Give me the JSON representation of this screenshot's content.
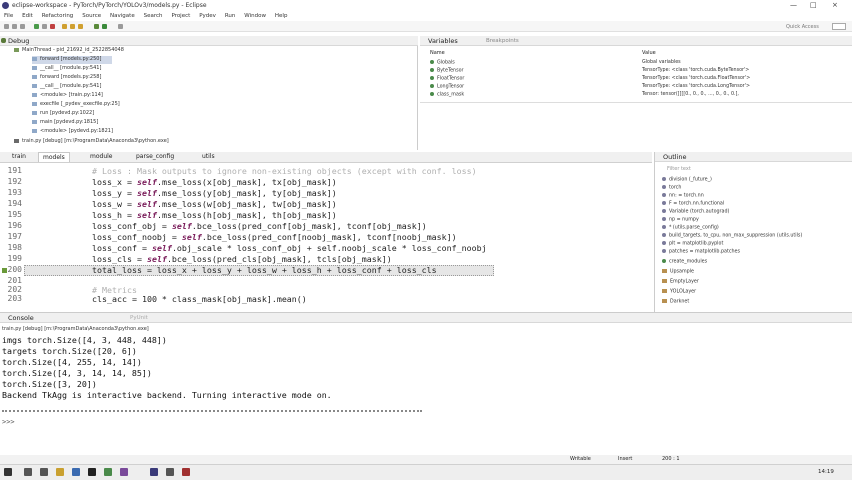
{
  "window": {
    "title": "eclipse-workspace - PyTorch/PyTorch/YOLOv3/models.py - Eclipse",
    "minimize": "—",
    "maximize": "□",
    "close": "×"
  },
  "menu": [
    "File",
    "Edit",
    "Refactoring",
    "Source",
    "Navigate",
    "Search",
    "Project",
    "Pydev",
    "Run",
    "Window",
    "Help"
  ],
  "toolbar": {
    "quick_access": "Quick Access"
  },
  "debug": {
    "title": "Debug",
    "thread": "MainThread - pid_21692_id_2522854048",
    "frames": [
      "forward [models.py:250]",
      "__call__ [module.py:541]",
      "forward [models.py:258]",
      "__call__ [module.py:541]",
      "<module> [train.py:114]",
      "execfile [_pydev_execfile.py:25]",
      "run [pydevd.py:1022]",
      "main [pydevd.py:1815]",
      "<module> [pydevd.py:1821]"
    ],
    "process": "train.py [debug] [m:\\ProgramData\\Anaconda3\\python.exe]"
  },
  "variables": {
    "title": "Variables",
    "other_tab": "Breakpoints",
    "col_name": "Name",
    "col_value": "Value",
    "rows": [
      {
        "name": "Globals",
        "value": "Global variables"
      },
      {
        "name": "ByteTensor",
        "value": "TensorType: <class 'torch.cuda.ByteTensor'>"
      },
      {
        "name": "FloatTensor",
        "value": "TensorType: <class 'torch.cuda.FloatTensor'>"
      },
      {
        "name": "LongTensor",
        "value": "TensorType: <class 'torch.cuda.LongTensor'>"
      },
      {
        "name": "class_mask",
        "value": "Tensor: tensor([[[[0., 0., 0., ..., 0., 0., 0.],"
      }
    ]
  },
  "editor": {
    "tabs": [
      "train",
      "models",
      "module",
      "parse_config",
      "utils"
    ],
    "active_tab": 1,
    "lines": [
      {
        "n": "191",
        "text": "# Loss : Mask outputs to ignore non-existing objects (except with conf. loss)",
        "kind": "comment"
      },
      {
        "n": "192",
        "pre": "loss_x = ",
        "self": "self",
        "post": ".mse_loss(x[obj_mask], tx[obj_mask])"
      },
      {
        "n": "193",
        "pre": "loss_y = ",
        "self": "self",
        "post": ".mse_loss(y[obj_mask], ty[obj_mask])"
      },
      {
        "n": "194",
        "pre": "loss_w = ",
        "self": "self",
        "post": ".mse_loss(w[obj_mask], tw[obj_mask])"
      },
      {
        "n": "195",
        "pre": "loss_h = ",
        "self": "self",
        "post": ".mse_loss(h[obj_mask], th[obj_mask])"
      },
      {
        "n": "196",
        "pre": "loss_conf_obj = ",
        "self": "self",
        "post": ".bce_loss(pred_conf[obj_mask], tconf[obj_mask])"
      },
      {
        "n": "197",
        "pre": "loss_conf_noobj = ",
        "self": "self",
        "post": ".bce_loss(pred_conf[noobj_mask], tconf[noobj_mask])"
      },
      {
        "n": "198",
        "pre": "loss_conf = ",
        "self": "self",
        "post": ".obj_scale * loss_conf_obj + self.noobj_scale * loss_conf_noobj"
      },
      {
        "n": "199",
        "pre": "loss_cls = ",
        "self": "self",
        "post": ".bce_loss(pred_cls[obj_mask], tcls[obj_mask])"
      },
      {
        "n": "200",
        "pre": "total_loss = loss_x + loss_y + loss_w + loss_h + loss_conf + loss_cls",
        "self": "",
        "post": "",
        "current": true
      },
      {
        "n": "201",
        "pre": "",
        "self": "",
        "post": ""
      },
      {
        "n": "202",
        "text": "# Metrics",
        "kind": "comment"
      },
      {
        "n": "203",
        "pre": "cls_acc = 100 * class_mask[obj_mask].mean()",
        "self": "",
        "post": ""
      }
    ]
  },
  "outline": {
    "title": "Outline",
    "filter": "Filter text",
    "items": [
      "division (_future_)",
      "torch",
      "nn: = torch.nn",
      "F = torch.nn.functional",
      "Variable (torch.autograd)",
      "np = numpy",
      "* (utils.parse_config)",
      "build_targets, to_cpu, non_max_suppression (utils.utils)",
      "plt = matplotlib.pyplot",
      "patches = matplotlib.patches",
      "create_modules",
      "Upsample",
      "EmptyLayer",
      "YOLOLayer",
      "Darknet"
    ]
  },
  "console": {
    "title": "Console",
    "other_tabs": "PyUnit",
    "process": "train.py [debug] [m:\\ProgramData\\Anaconda3\\python.exe]",
    "lines": [
      "imgs torch.Size([4, 3, 448, 448])",
      "targets torch.Size([20, 6])",
      "torch.Size([4, 255, 14, 14])",
      "torch.Size([4, 3, 14, 14, 85])",
      "torch.Size([3, 20])",
      "Backend TkAgg is interactive backend. Turning interactive mode on."
    ],
    "prompt": ">>>"
  },
  "status": {
    "writable": "Writable",
    "insert": "Insert",
    "position": "200 : 1",
    "time": "14:19"
  }
}
